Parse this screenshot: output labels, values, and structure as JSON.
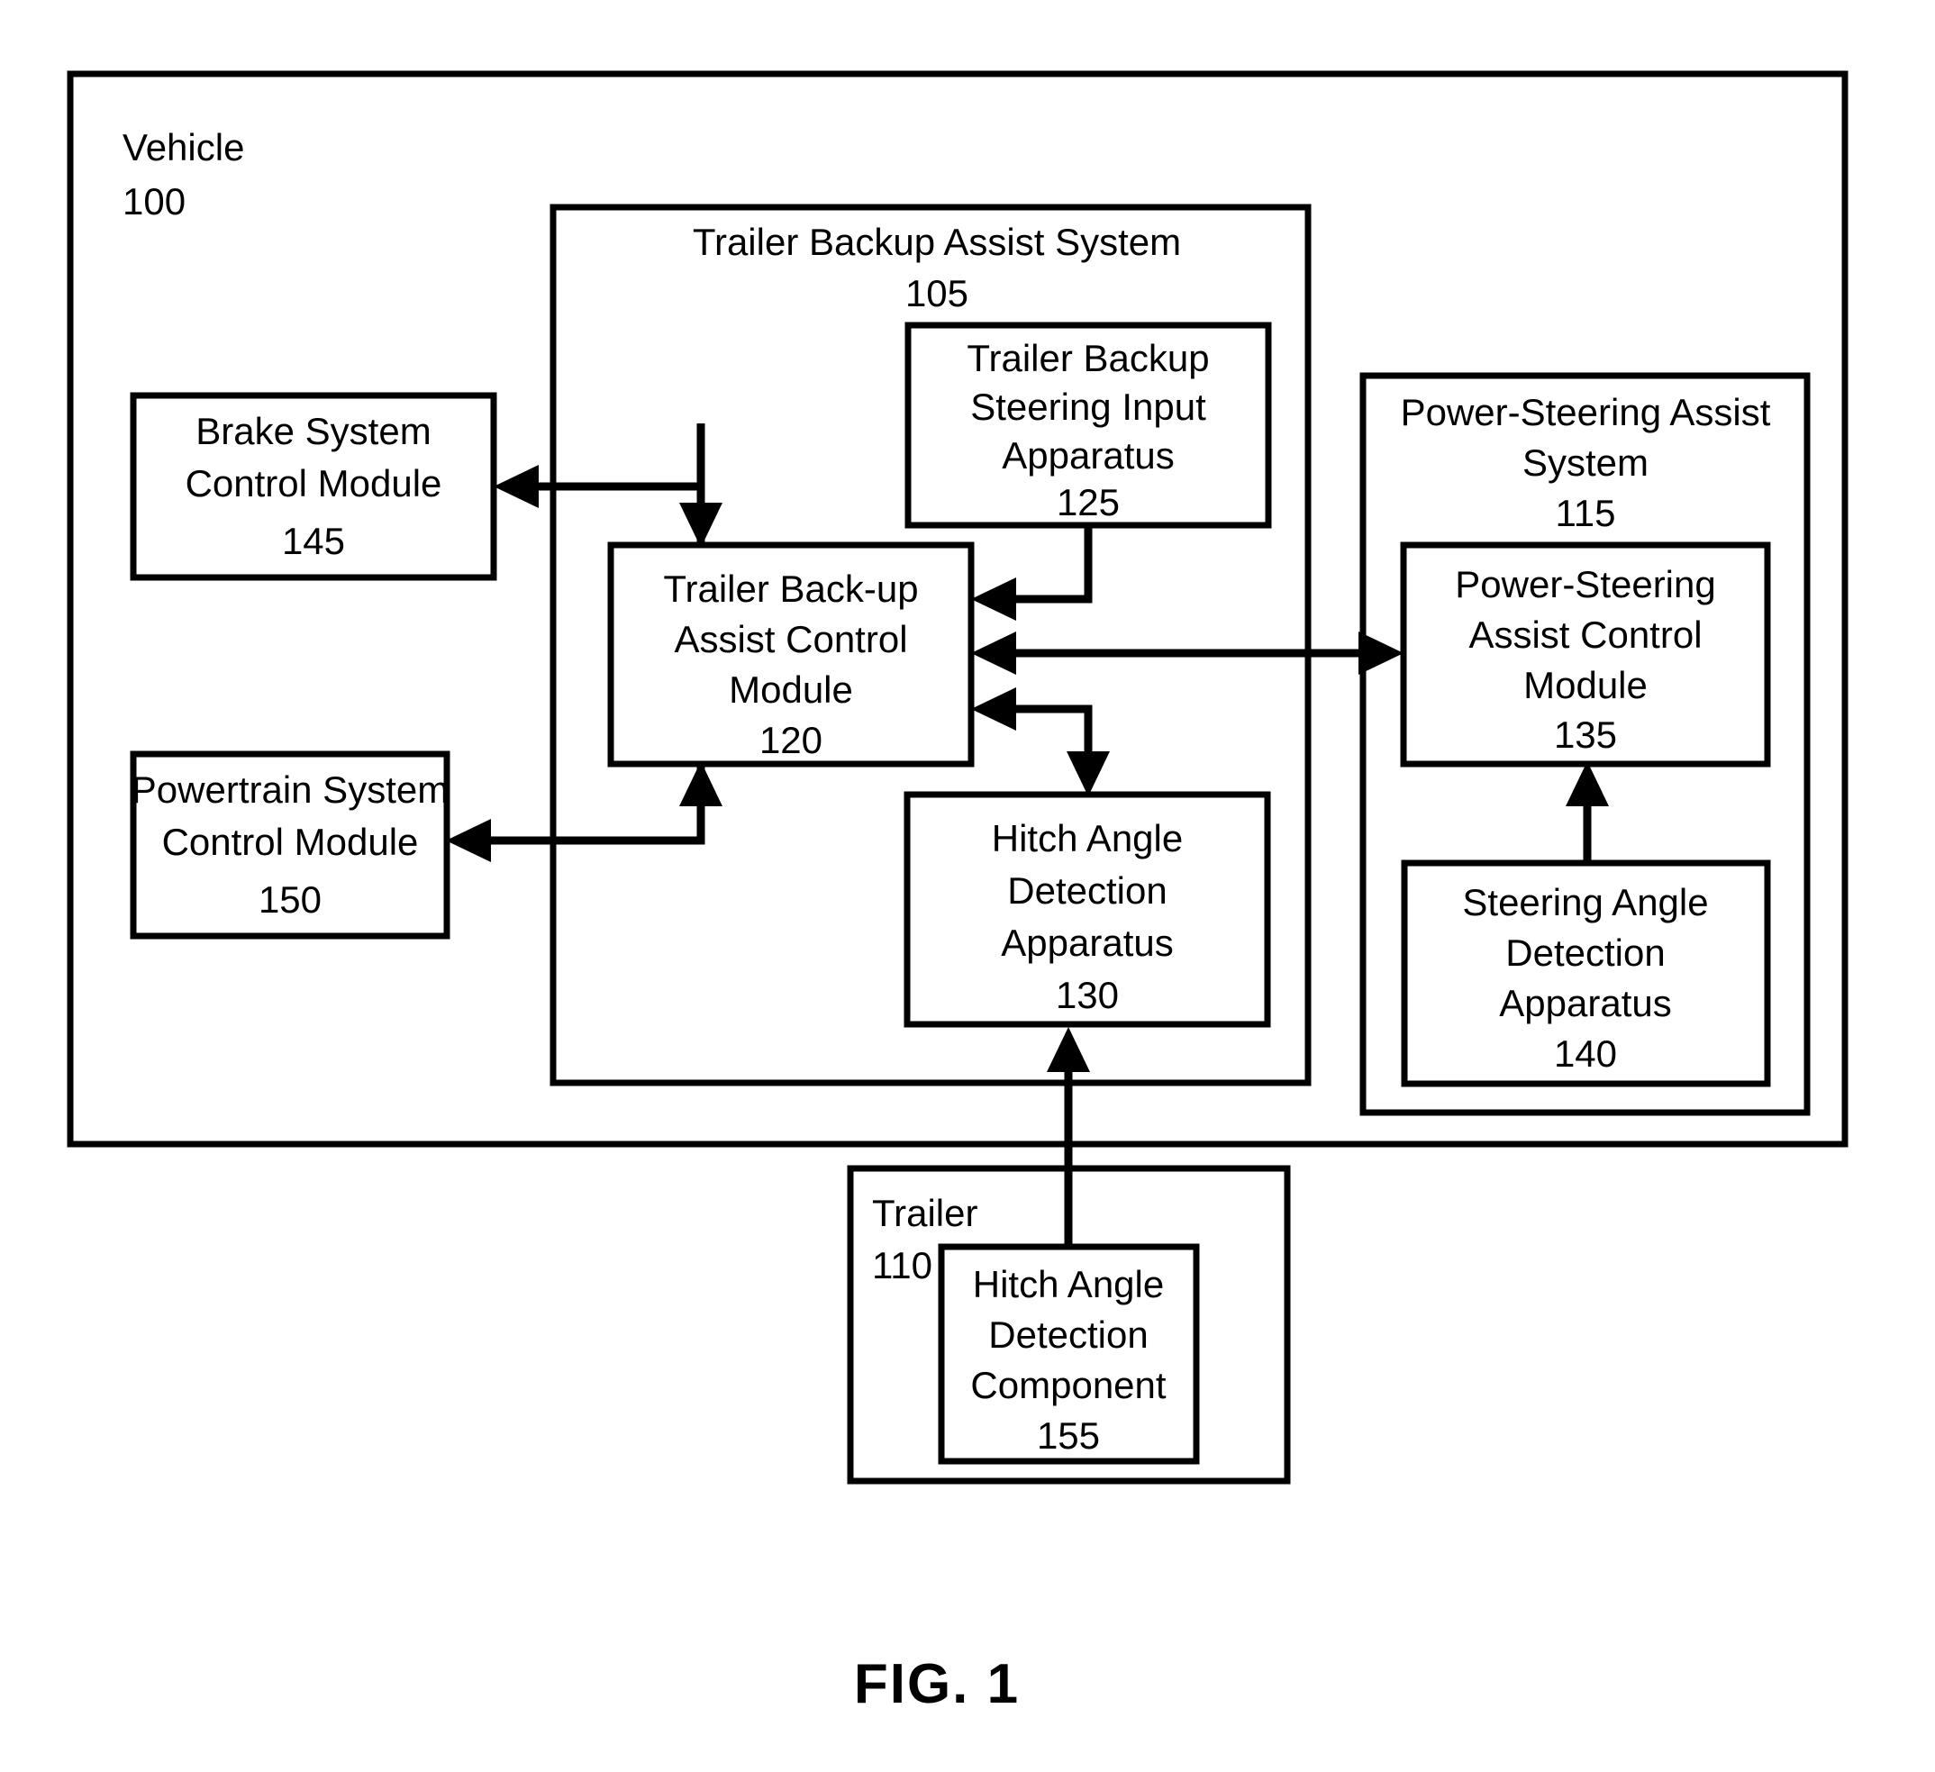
{
  "figure": {
    "caption": "FIG. 1"
  },
  "containers": [
    {
      "id": "vehicle",
      "name": "Vehicle",
      "ref": "100",
      "label_lines": [
        "Vehicle",
        "100"
      ]
    },
    {
      "id": "trailer-backup-assist-system",
      "name": "Trailer Backup Assist System",
      "ref": "105",
      "label_lines": [
        "Trailer Backup Assist System",
        "105"
      ]
    },
    {
      "id": "power-steering-assist-system",
      "name": "Power-Steering Assist System",
      "ref": "115",
      "label_lines": [
        "Power-Steering Assist",
        "System",
        "115"
      ]
    },
    {
      "id": "trailer",
      "name": "Trailer",
      "ref": "110",
      "label_lines": [
        "Trailer",
        "110"
      ]
    }
  ],
  "blocks": [
    {
      "id": "brake-system-control-module",
      "ref": "145",
      "lines": [
        "Brake System",
        "Control Module",
        "145"
      ]
    },
    {
      "id": "powertrain-system-control-module",
      "ref": "150",
      "lines": [
        "Powertrain System",
        "Control Module",
        "150"
      ]
    },
    {
      "id": "trailer-backup-steering-input-apparatus",
      "ref": "125",
      "lines": [
        "Trailer Backup",
        "Steering Input",
        "Apparatus",
        "125"
      ]
    },
    {
      "id": "trailer-backup-assist-control-module",
      "ref": "120",
      "lines": [
        "Trailer Back-up",
        "Assist Control",
        "Module",
        "120"
      ]
    },
    {
      "id": "hitch-angle-detection-apparatus",
      "ref": "130",
      "lines": [
        "Hitch Angle",
        "Detection",
        "Apparatus",
        "130"
      ]
    },
    {
      "id": "power-steering-assist-control-module",
      "ref": "135",
      "lines": [
        "Power-Steering",
        "Assist Control",
        "Module",
        "135"
      ]
    },
    {
      "id": "steering-angle-detection-apparatus",
      "ref": "140",
      "lines": [
        "Steering Angle",
        "Detection",
        "Apparatus",
        "140"
      ]
    },
    {
      "id": "hitch-angle-detection-component",
      "ref": "155",
      "lines": [
        "Hitch Angle",
        "Detection",
        "Component",
        "155"
      ]
    }
  ],
  "connections": [
    {
      "id": "tbacm-to-brake",
      "from": "trailer-backup-assist-control-module",
      "to": "brake-system-control-module",
      "direction": "one-way"
    },
    {
      "id": "tbacm-to-powertrain",
      "from": "trailer-backup-assist-control-module",
      "to": "powertrain-system-control-module",
      "direction": "one-way"
    },
    {
      "id": "steering-input-to-tbacm",
      "from": "trailer-backup-steering-input-apparatus",
      "to": "trailer-backup-assist-control-module",
      "direction": "one-way"
    },
    {
      "id": "tbacm-to-psacm",
      "from": "trailer-backup-assist-control-module",
      "to": "power-steering-assist-control-module",
      "direction": "bidirectional"
    },
    {
      "id": "hitch-apparatus-to-tbacm",
      "from": "hitch-angle-detection-apparatus",
      "to": "trailer-backup-assist-control-module",
      "direction": "bidirectional"
    },
    {
      "id": "steering-angle-to-psacm",
      "from": "steering-angle-detection-apparatus",
      "to": "power-steering-assist-control-module",
      "direction": "one-way"
    },
    {
      "id": "hitch-component-to-apparatus",
      "from": "hitch-angle-detection-component",
      "to": "hitch-angle-detection-apparatus",
      "direction": "one-way"
    }
  ],
  "colors": {
    "stroke": "#000000",
    "fill": "#ffffff",
    "background": "#ffffff"
  }
}
